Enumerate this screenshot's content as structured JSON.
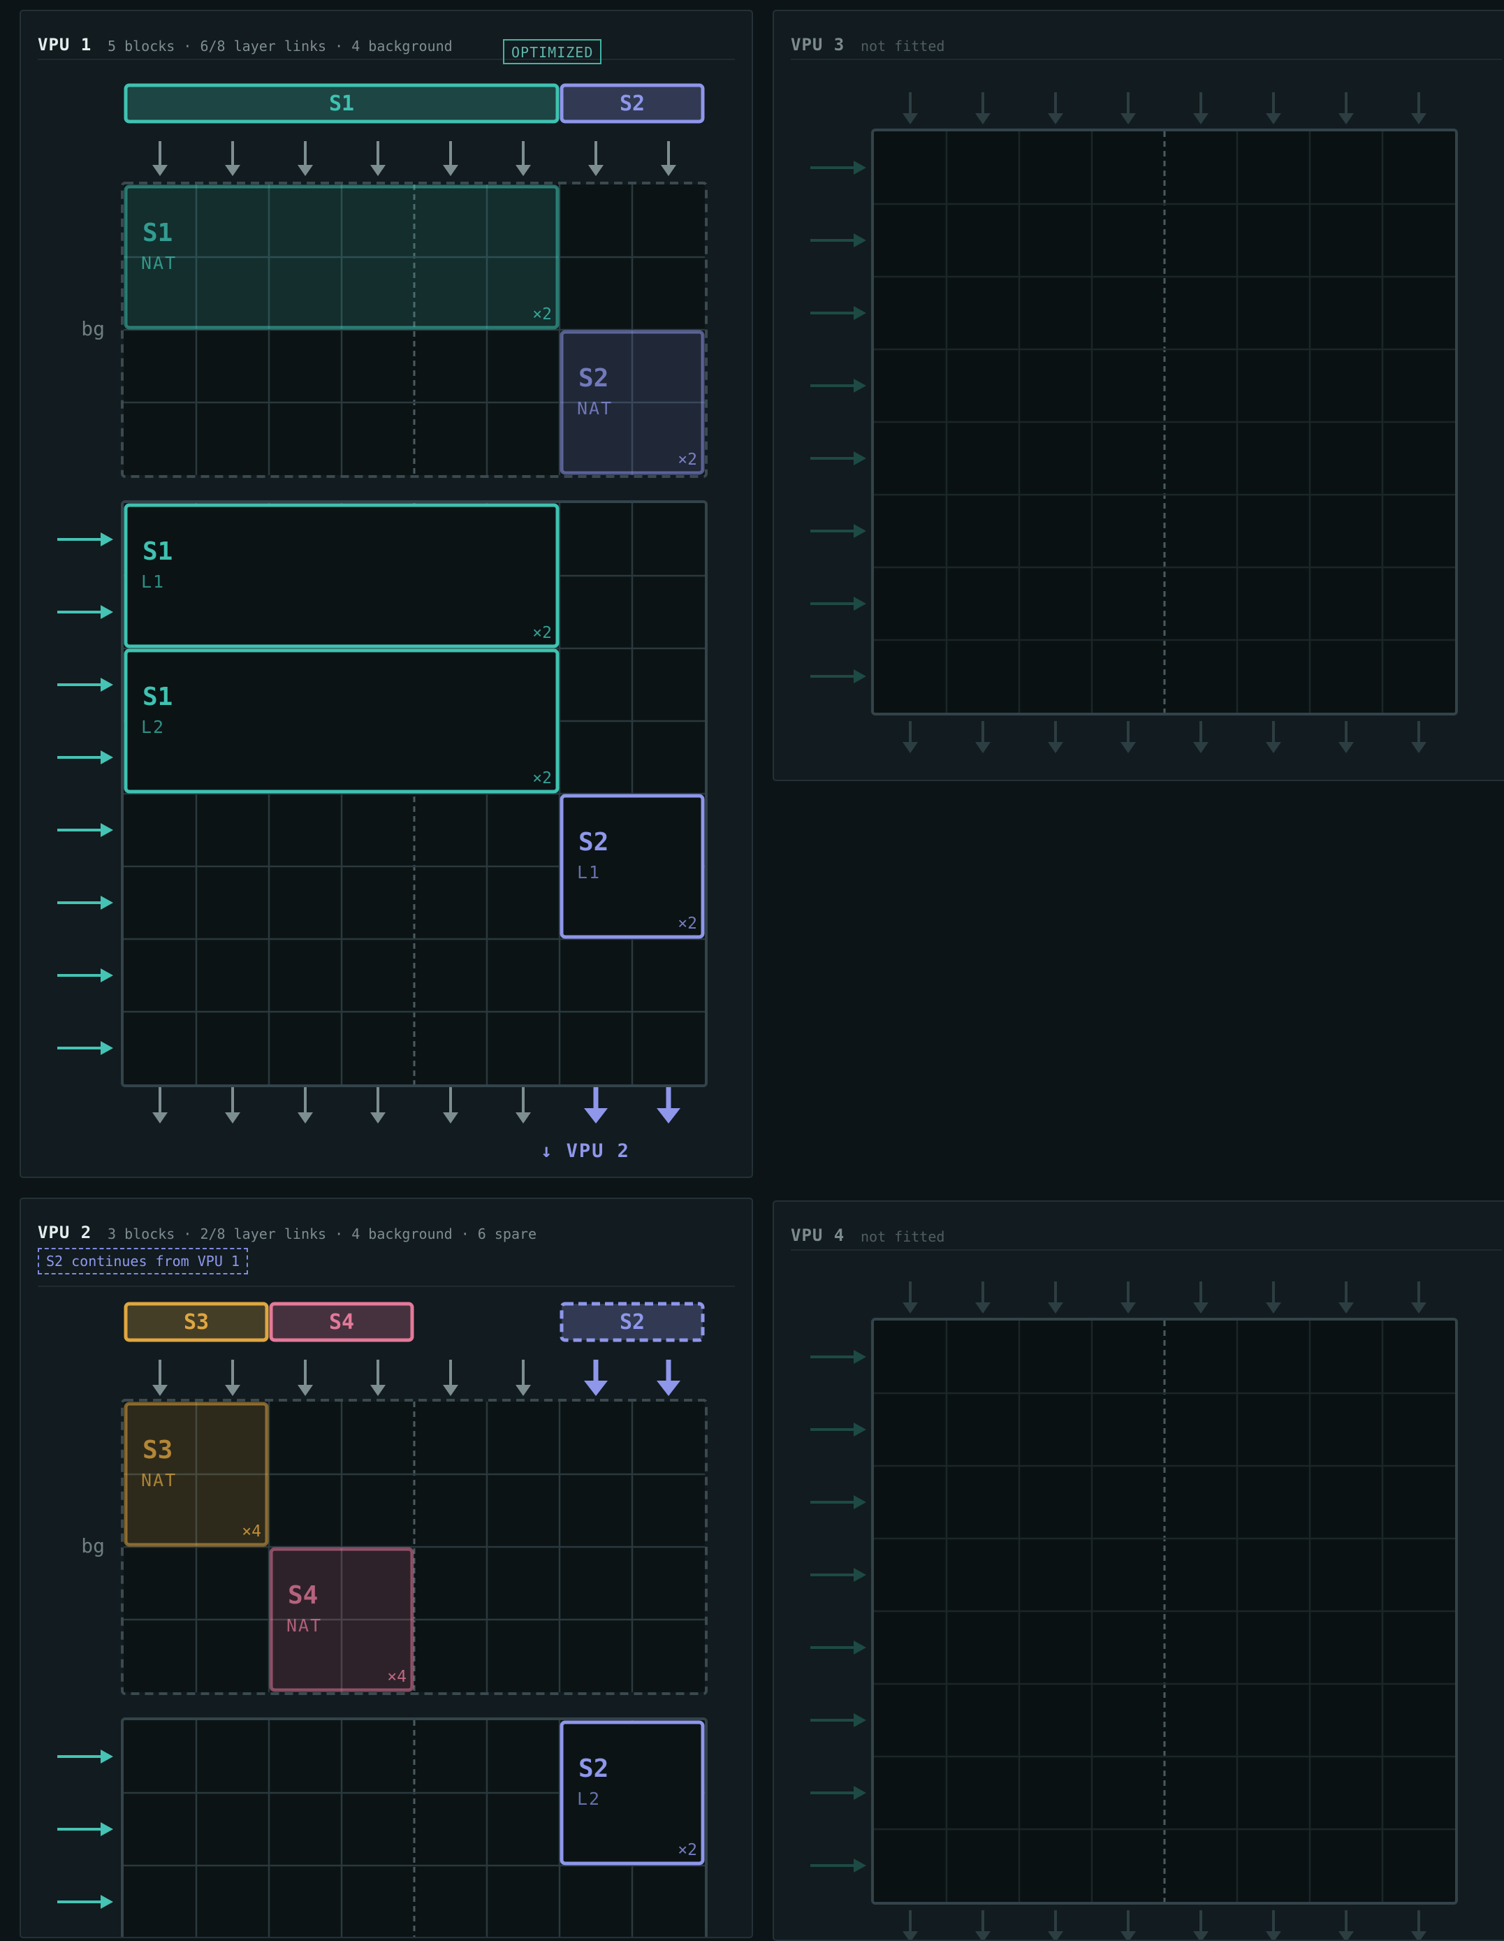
{
  "colors": {
    "s1": "#3fc2b1",
    "s2": "#8e97ea",
    "s3": "#e0a640",
    "s4": "#e4799a",
    "grid": "#2a393e",
    "cell": "#0a1113",
    "arrow_gray": "#7d8e91",
    "arrow_teal": "#45c3b4"
  },
  "vpu1": {
    "title": "VPU 1",
    "meta": "5 blocks · 6/8 layer links · 4 background",
    "badge": "OPTIMIZED",
    "bg_label": "bg",
    "out_label": "↓ VPU 2",
    "tags": [
      {
        "label": "S1",
        "stream": "s1",
        "col": 0,
        "span": 6,
        "dashed": false
      },
      {
        "label": "S2",
        "stream": "s2",
        "col": 6,
        "span": 2,
        "dashed": false
      }
    ],
    "blocks": [
      {
        "grid": "bg",
        "stream": "s1",
        "label": "S1",
        "sub": "NAT",
        "mult": "×2",
        "row": 0,
        "col": 0,
        "rows": 2,
        "cols": 6,
        "variant": "bg"
      },
      {
        "grid": "bg",
        "stream": "s2",
        "label": "S2",
        "sub": "NAT",
        "mult": "×2",
        "row": 2,
        "col": 6,
        "rows": 2,
        "cols": 2,
        "variant": "bg"
      },
      {
        "grid": "main",
        "stream": "s1",
        "label": "S1",
        "sub": "L1",
        "mult": "×2",
        "row": 0,
        "col": 0,
        "rows": 2,
        "cols": 6,
        "variant": "layer"
      },
      {
        "grid": "main",
        "stream": "s1",
        "label": "S1",
        "sub": "L2",
        "mult": "×2",
        "row": 2,
        "col": 0,
        "rows": 2,
        "cols": 6,
        "variant": "layer"
      },
      {
        "grid": "main",
        "stream": "s2",
        "label": "S2",
        "sub": "L1",
        "mult": "×2",
        "row": 4,
        "col": 6,
        "rows": 2,
        "cols": 2,
        "variant": "layer"
      }
    ],
    "top_highlight_cols": [],
    "out_highlight_cols": [
      6,
      7
    ]
  },
  "vpu2": {
    "title": "VPU 2",
    "meta": "3 blocks · 2/8 layer links · 4 background · 6 spare",
    "note": "S2 continues from VPU 1",
    "bg_label": "bg",
    "tags": [
      {
        "label": "S3",
        "stream": "s3",
        "col": 0,
        "span": 2,
        "dashed": false
      },
      {
        "label": "S4",
        "stream": "s4",
        "col": 2,
        "span": 2,
        "dashed": false
      },
      {
        "label": "S2",
        "stream": "s2",
        "col": 6,
        "span": 2,
        "dashed": true
      }
    ],
    "blocks": [
      {
        "grid": "bg",
        "stream": "s3",
        "label": "S3",
        "sub": "NAT",
        "mult": "×4",
        "row": 0,
        "col": 0,
        "rows": 2,
        "cols": 2,
        "variant": "bg"
      },
      {
        "grid": "bg",
        "stream": "s4",
        "label": "S4",
        "sub": "NAT",
        "mult": "×4",
        "row": 2,
        "col": 2,
        "rows": 2,
        "cols": 2,
        "variant": "bg"
      },
      {
        "grid": "main",
        "stream": "s2",
        "label": "S2",
        "sub": "L2",
        "mult": "×2",
        "row": 0,
        "col": 6,
        "rows": 2,
        "cols": 2,
        "variant": "layer"
      }
    ],
    "top_highlight_cols": [
      6,
      7
    ]
  },
  "vpu3": {
    "title": "VPU 3",
    "meta": "not fitted"
  },
  "vpu4": {
    "title": "VPU 4",
    "meta": "not fitted"
  }
}
